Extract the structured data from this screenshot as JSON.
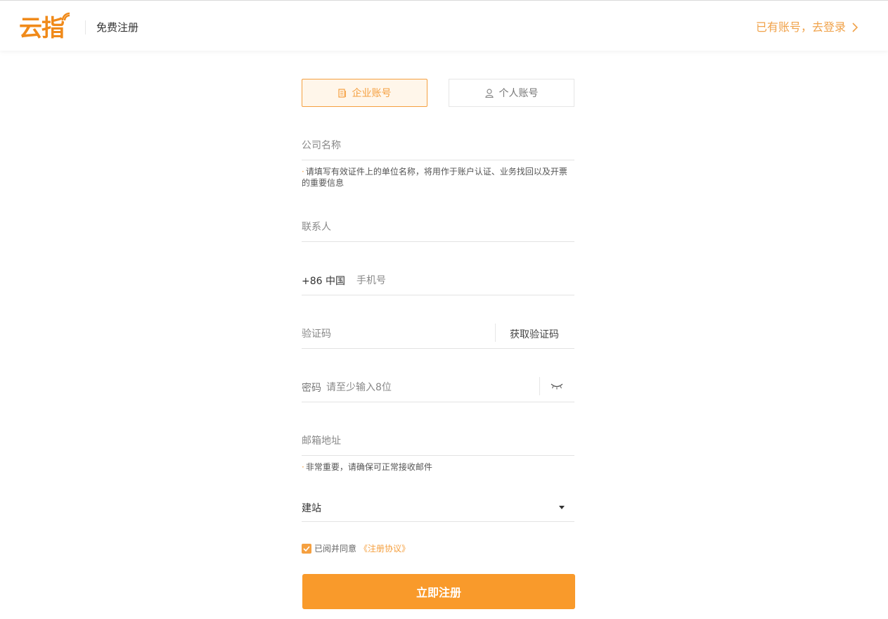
{
  "header": {
    "logo_text": "云指",
    "title": "免费注册",
    "login_link": "已有账号，去登录"
  },
  "tabs": {
    "enterprise": "企业账号",
    "personal": "个人账号"
  },
  "form": {
    "company": {
      "placeholder": "公司名称",
      "hint": "请填写有效证件上的单位名称，将用作于账户认证、业务找回以及开票的重要信息"
    },
    "contact": {
      "placeholder": "联系人"
    },
    "phone": {
      "prefix": "+86 中国",
      "placeholder": "手机号"
    },
    "code": {
      "placeholder": "验证码",
      "button": "获取验证码"
    },
    "password": {
      "label": "密码",
      "placeholder": "请至少输入8位"
    },
    "email": {
      "placeholder": "邮箱地址",
      "hint": "非常重要，请确保可正常接收邮件"
    },
    "purpose": {
      "selected": "建站"
    },
    "agree": {
      "text": "已阅并同意",
      "link": "《注册协议》"
    },
    "submit": "立即注册"
  },
  "colors": {
    "accent": "#f5a040",
    "button": "#f99a2b"
  },
  "icons": {
    "tab_enterprise": "document-icon",
    "tab_personal": "user-icon",
    "password_toggle": "eye-closed-icon",
    "select_caret": "caret-down-icon",
    "agree_check": "checkmark-icon",
    "login_chevron": "chevron-right-icon"
  }
}
